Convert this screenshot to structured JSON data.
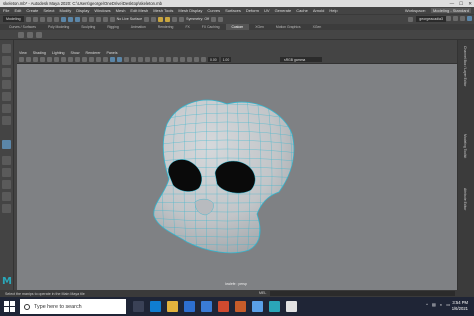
{
  "window": {
    "title": "skeleton.mb* - Autodesk Maya 2020: C:\\Users\\george\\OneDrive\\Desktop\\skeleton.mb",
    "minimize": "—",
    "maximize": "☐",
    "close": "✕"
  },
  "menubar": {
    "items": [
      "File",
      "Edit",
      "Create",
      "Select",
      "Modify",
      "Display",
      "Windows",
      "Mesh",
      "Edit Mesh",
      "Mesh Tools",
      "Mesh Display",
      "Curves",
      "Surfaces",
      "Deform",
      "UV",
      "Generate",
      "Cache",
      "Arnold",
      "Help"
    ],
    "workspace_label": "Workspace:",
    "workspace_value": "Modeling - Standard"
  },
  "statusline": {
    "mode": "Modeling",
    "live_surface": "No Live Surface",
    "symmetry": "Symmetry: Off",
    "user": "georgeacadia3"
  },
  "shelf_tabs": {
    "items": [
      "Curves / Surfaces",
      "Poly Modeling",
      "Sculpting",
      "Rigging",
      "Animation",
      "Rendering",
      "FX",
      "FX Caching",
      "Custom",
      "XGen",
      "Motion Graphics",
      "XGen"
    ],
    "active_index": 8
  },
  "panel": {
    "menu": [
      "View",
      "Shading",
      "Lighting",
      "Show",
      "Renderer",
      "Panels"
    ],
    "near_clip": "0.00",
    "far_clip": "1.00",
    "color_space": "sRGB gamma",
    "camera_label": "lowlefe : persp"
  },
  "right_strip": {
    "labels": [
      "Channel Box / Layer Editor",
      "Modeling Toolkit",
      "Attribute Editor"
    ]
  },
  "logo": "M",
  "helpline": {
    "text": "Select the manips to operate in the Main Maya tile",
    "mel_label": "MEL"
  },
  "taskbar": {
    "search_placeholder": "Type here to search",
    "time": "3:54 PM",
    "date": "1/6/2021"
  },
  "colors": {
    "viewport_bg": "#7f8184",
    "mesh_fill": "#c5c8cb",
    "wire": "#33b6cf",
    "maya_accent": "#2aa6b8",
    "taskbar_bg": "#1f2536"
  }
}
